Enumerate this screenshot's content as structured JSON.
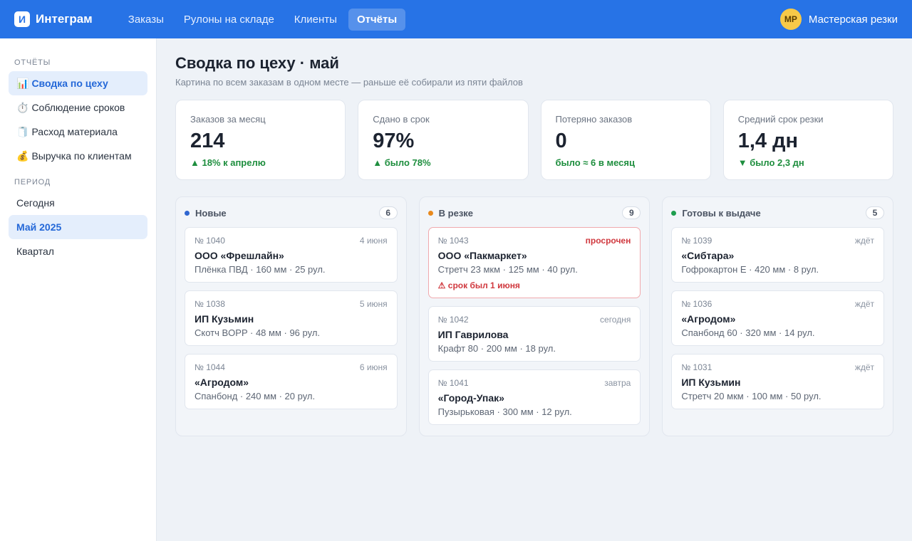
{
  "header": {
    "logo_letter": "И",
    "brand": "Интеграм",
    "nav": [
      {
        "label": "Заказы"
      },
      {
        "label": "Рулоны на складе"
      },
      {
        "label": "Клиенты"
      },
      {
        "label": "Отчёты",
        "active": true
      }
    ],
    "user": {
      "initials": "МР",
      "name": "Мастерская резки"
    }
  },
  "sidebar": {
    "reports_title": "ОТЧЁТЫ",
    "reports": [
      {
        "icon": "📊",
        "icon_name": "bar-chart-icon",
        "label": "Сводка по цеху",
        "active": true
      },
      {
        "icon": "⏱️",
        "icon_name": "stopwatch-icon",
        "label": "Соблюдение сроков"
      },
      {
        "icon": "🧻",
        "icon_name": "roll-icon",
        "label": "Расход материала"
      },
      {
        "icon": "💰",
        "icon_name": "money-bag-icon",
        "label": "Выручка по клиентам"
      }
    ],
    "period_title": "ПЕРИОД",
    "periods": [
      {
        "label": "Сегодня"
      },
      {
        "label": "Май 2025",
        "active": true
      },
      {
        "label": "Квартал"
      }
    ]
  },
  "main": {
    "title": "Сводка по цеху · май",
    "subtitle": "Картина по всем заказам в одном месте — раньше её собирали из пяти файлов",
    "kpis": [
      {
        "label": "Заказов за месяц",
        "value": "214",
        "delta": "▲ 18% к апрелю"
      },
      {
        "label": "Сдано в срок",
        "value": "97%",
        "delta": "▲ было 78%"
      },
      {
        "label": "Потеряно заказов",
        "value": "0",
        "delta": "было ≈ 6 в месяц"
      },
      {
        "label": "Средний срок резки",
        "value": "1,4 дн",
        "delta": "▼ было 2,3 дн"
      }
    ],
    "columns": [
      {
        "title": "Новые",
        "count": "6",
        "color": "#2f66d0",
        "cards": [
          {
            "number": "№ 1040",
            "status": "4 июня",
            "client": "ООО «Фрешлайн»",
            "desc": "Плёнка ПВД · 160 мм · 25 рул."
          },
          {
            "number": "№ 1038",
            "status": "5 июня",
            "client": "ИП Кузьмин",
            "desc": "Скотч BOPP · 48 мм · 96 рул."
          },
          {
            "number": "№ 1044",
            "status": "6 июня",
            "client": "«Агродом»",
            "desc": "Спанбонд · 240 мм · 20 рул."
          }
        ]
      },
      {
        "title": "В резке",
        "count": "9",
        "color": "#e8891c",
        "cards": [
          {
            "number": "№ 1043",
            "status": "просрочен",
            "overdue": true,
            "client": "ООО «Пакмаркет»",
            "desc": "Стретч 23 мкм · 125 мм · 40 рул.",
            "warning": "⚠ срок был 1 июня"
          },
          {
            "number": "№ 1042",
            "status": "сегодня",
            "client": "ИП Гаврилова",
            "desc": "Крафт 80 · 200 мм · 18 рул."
          },
          {
            "number": "№ 1041",
            "status": "завтра",
            "client": "«Город-Упак»",
            "desc": "Пузырьковая · 300 мм · 12 рул."
          }
        ]
      },
      {
        "title": "Готовы к выдаче",
        "count": "5",
        "color": "#1e9e4e",
        "cards": [
          {
            "number": "№ 1039",
            "status": "ждёт",
            "client": "«Сибтара»",
            "desc": "Гофрокартон E · 420 мм · 8 рул."
          },
          {
            "number": "№ 1036",
            "status": "ждёт",
            "client": "«Агродом»",
            "desc": "Спанбонд 60 · 320 мм · 14 рул."
          },
          {
            "number": "№ 1031",
            "status": "ждёт",
            "client": "ИП Кузьмин",
            "desc": "Стретч 20 мкм · 100 мм · 50 рул."
          }
        ]
      }
    ]
  }
}
